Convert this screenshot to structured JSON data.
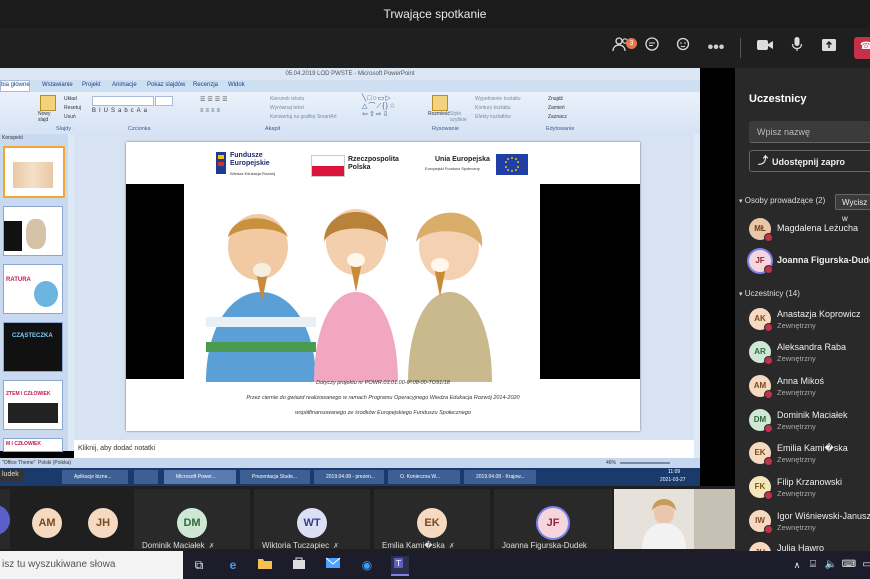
{
  "window": {
    "title": "Trwające spotkanie"
  },
  "toolbar": {
    "participants_badge": "3",
    "participants_icon": "people-icon",
    "chat_icon": "chat-icon",
    "reactions_icon": "reactions-icon",
    "more_icon": "more-icon",
    "camera_icon": "camera-icon",
    "mic_icon": "mic-icon",
    "share_icon": "share-tray-icon"
  },
  "powerpoint": {
    "title": "05.04.2019 LOD PWSTE - Microsoft PowerPoint",
    "tabs": [
      "bia główne",
      "Wstawianie",
      "Projekt",
      "Animacje",
      "Pokaz slajdów",
      "Recenzja",
      "Widok"
    ],
    "ribbon_groups": [
      "Slajdy",
      "Czcionka",
      "Akapit",
      "Rysowanie",
      "Edytowanie"
    ],
    "ribbon_buttons": {
      "new_slide": "Nowy slajd",
      "layout": "Układ",
      "reset": "Resetuj",
      "delete": "Usuń",
      "text_direction": "Kierunek tekstu",
      "align_text": "Wyrównaj tekst",
      "smartart": "Konwertuj na grafikę SmartArt",
      "arrange": "Rozmieść",
      "quick_styles": "Style szybkie",
      "fill": "Wypełnienie kształtu",
      "outline": "Kontury kształtu",
      "effects": "Efekty kształtów",
      "find": "Znajdź",
      "replace": "Zamień",
      "select": "Zaznacz"
    },
    "slides_tab": "Konspekt",
    "thumb_labels": [
      "",
      "",
      "RATURA",
      "CZĄSTECZKA",
      "ZTEM I CZŁOWIEK",
      "M I CZŁOWIEK"
    ],
    "slide": {
      "logo1_title": "Fundusze Europejskie",
      "logo1_sub": "Wiedza Edukacja Rozwój",
      "logo2_title": "Rzeczpospolita Polska",
      "logo3_title": "Unia Europejska",
      "logo3_sub": "Europejski Fundusz Społeczny",
      "caption1": "Dotyczy projektu nr POWR.03.01.00-IP.08-00-TO91/18",
      "caption2": "Przez ciernie do gwiazd realizowanego w ramach Programu Operacyjnego Wiedza Edukacja Rozwój 2014-2020",
      "caption3": "współfinansowanego ze środków Europejskiego Funduszu Społecznego"
    },
    "notes_placeholder": "Kliknij, aby dodać notatki",
    "status": {
      "theme": "\"Office Theme\"",
      "language": "Polski (Polska)",
      "zoom": "46%"
    },
    "win_tasks": [
      "Aplikacje bizne...",
      "",
      "Microsoft Power...",
      "Prezentacja Stude...",
      "2019.04.08 - prezen...",
      "O. Konieczna W...",
      "2019.04.08 - Krajow..."
    ],
    "clock_time": "11:09",
    "clock_date": "2021-03-27"
  },
  "presenter_label": "ludek",
  "strip": [
    {
      "initials": "",
      "name": ""
    },
    {
      "initials": "AM",
      "name": ""
    },
    {
      "initials": "JH",
      "name": ""
    },
    {
      "initials": "DM",
      "name": "Dominik Maciałek"
    },
    {
      "initials": "WT",
      "name": "Wiktoria Tuczapiec"
    },
    {
      "initials": "EK",
      "name": "Emilia Kami�ska"
    },
    {
      "initials": "JF",
      "name": "Joanna Figurska-Dudek"
    }
  ],
  "panel": {
    "title": "Uczestnicy",
    "search_placeholder": "Wpisz nazwę",
    "share_label": "Udostępnij zapro",
    "presenters_header": "Osoby prowadzące (2)",
    "mute_all": "Wycisz w",
    "attendees_header": "Uczestnicy (14)",
    "presenters": [
      {
        "initials": "MŁ",
        "name": "Magdalena Leżucha",
        "role": ""
      },
      {
        "initials": "JF",
        "name": "Joanna Figurska-Dudek",
        "role": ""
      }
    ],
    "attendees": [
      {
        "initials": "AK",
        "name": "Anastazja Koprowicz",
        "role": "Zewnętrzny"
      },
      {
        "initials": "AR",
        "name": "Aleksandra Raba",
        "role": "Zewnętrzny"
      },
      {
        "initials": "AM",
        "name": "Anna Mikoś",
        "role": "Zewnętrzny"
      },
      {
        "initials": "DM",
        "name": "Dominik Maciałek",
        "role": "Zewnętrzny"
      },
      {
        "initials": "EK",
        "name": "Emilia Kami�ska",
        "role": "Zewnętrzny"
      },
      {
        "initials": "FK",
        "name": "Filip Krzanowski",
        "role": "Zewnętrzny"
      },
      {
        "initials": "IW",
        "name": "Igor Wiśniewski-Janusz",
        "role": "Zewnętrzny"
      },
      {
        "initials": "JH",
        "name": "Julia Hawro",
        "role": ""
      }
    ]
  },
  "taskbar": {
    "search_placeholder": "isz tu wyszukiwane słowa"
  },
  "colors": {
    "teams_bg": "#1f1f1f",
    "leave_red": "#c4314b",
    "avatar_accent": "#e97548"
  }
}
